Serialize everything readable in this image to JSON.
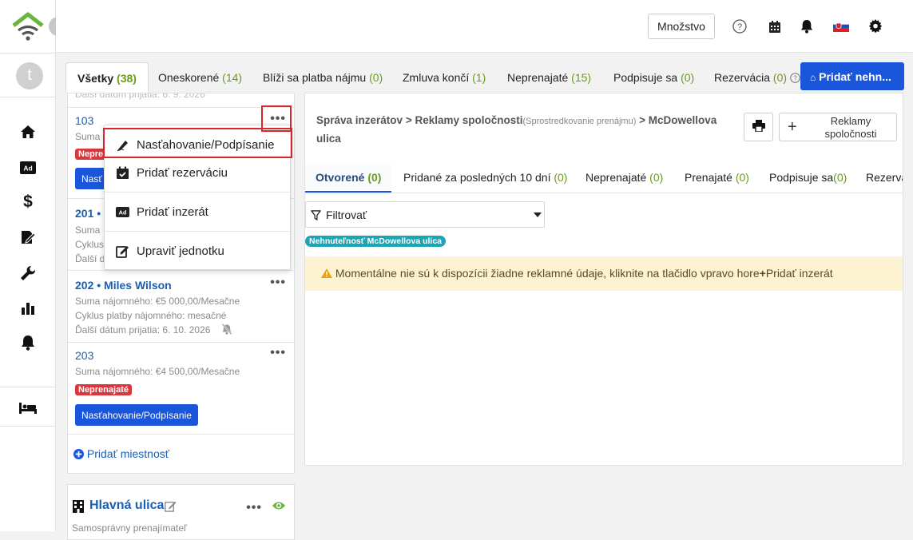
{
  "toolbar": {
    "quantity_label": "Množstvo",
    "help_icon": "question-circle-icon",
    "calendar_icon": "calendar-icon",
    "bell_icon": "bell-icon",
    "flag_icon": "slovakia-flag-icon",
    "settings_icon": "gear-icon"
  },
  "sidebar": {
    "avatar_initial": "t",
    "items": [
      {
        "icon": "home-icon"
      },
      {
        "icon": "ad-icon"
      },
      {
        "icon": "dollar-icon"
      },
      {
        "icon": "signature-icon"
      },
      {
        "icon": "wrench-icon"
      },
      {
        "icon": "chart-icon"
      },
      {
        "icon": "bell-icon"
      },
      {
        "icon": "bed-icon"
      }
    ]
  },
  "tabs": [
    {
      "label": "Všetky",
      "count": "(38)"
    },
    {
      "label": "Oneskorené",
      "count": "(14)"
    },
    {
      "label": "Blíži sa platba nájmu",
      "count": "(0)"
    },
    {
      "label": "Zmluva končí",
      "count": "(1)"
    },
    {
      "label": "Neprenajaté",
      "count": "(15)"
    },
    {
      "label": "Podpisuje sa",
      "count": "(0)"
    },
    {
      "label": "Rezervácia",
      "count": "(0)"
    }
  ],
  "add_property_label": "Pridať nehn...",
  "units": [
    {
      "number": "103",
      "rent_line": "Suma",
      "badge": "Neprena",
      "button": "Nasť"
    },
    {
      "number": "201",
      "tenant": "• M",
      "rent_line": "Suma",
      "cycle_line": "Cyklus",
      "next_line": "Ďalší d"
    },
    {
      "number": "202",
      "tenant": "• Miles Wilson",
      "rent_line": "Suma nájomného: €5 000,00/Mesačne",
      "cycle_line": "Cyklus platby nájomného: mesačné",
      "next_line": "Ďalší dátum prijatia:  6. 10. 2026"
    },
    {
      "number": "203",
      "rent_line": "Suma nájomného: €4 500,00/Mesačne",
      "badge": "Neprenajaté",
      "button": "Nasťahovanie/Podpísanie"
    }
  ],
  "add_room_label": "Pridať miestnosť",
  "property2": {
    "name": "Hlavná ulica",
    "subtitle": "Samosprávny prenajímateľ"
  },
  "dropdown_menu": [
    {
      "label": "Nasťahovanie/Podpísanie",
      "icon": "signature-icon"
    },
    {
      "label": "Pridať rezerváciu",
      "icon": "calendar-check-icon"
    },
    {
      "label": "Pridať inzerát",
      "icon": "ad-icon"
    },
    {
      "label": "Upraviť jednotku",
      "icon": "edit-icon"
    }
  ],
  "breadcrumb": {
    "part1": "Správa inzerátov",
    "sep": ">",
    "part2": "Reklamy spoločnosti",
    "part2_note": "(Sprostredkovanie prenájmu)",
    "part3": "McDowellova ulica"
  },
  "company_ads_button": "Reklamy spoločnosti",
  "subtabs": [
    {
      "label": "Otvorené",
      "count": "(0)"
    },
    {
      "label": "Pridané za posledných 10 dní",
      "count": "(0)"
    },
    {
      "label": "Neprenajaté",
      "count": "(0)"
    },
    {
      "label": "Prenajaté",
      "count": "(0)"
    },
    {
      "label": "Podpisuje sa",
      "count": "(0)"
    },
    {
      "label": "Rezervá",
      "count": ""
    }
  ],
  "filter_label": "Filtrovať",
  "property_chip": "Nehnuteľnosť McDowellova ulica",
  "warning": {
    "text": "Momentálne nie sú k dispozícii žiadne reklamné údaje, kliknite na tlačidlo vpravo hore",
    "link": "Pridať inzerát"
  }
}
